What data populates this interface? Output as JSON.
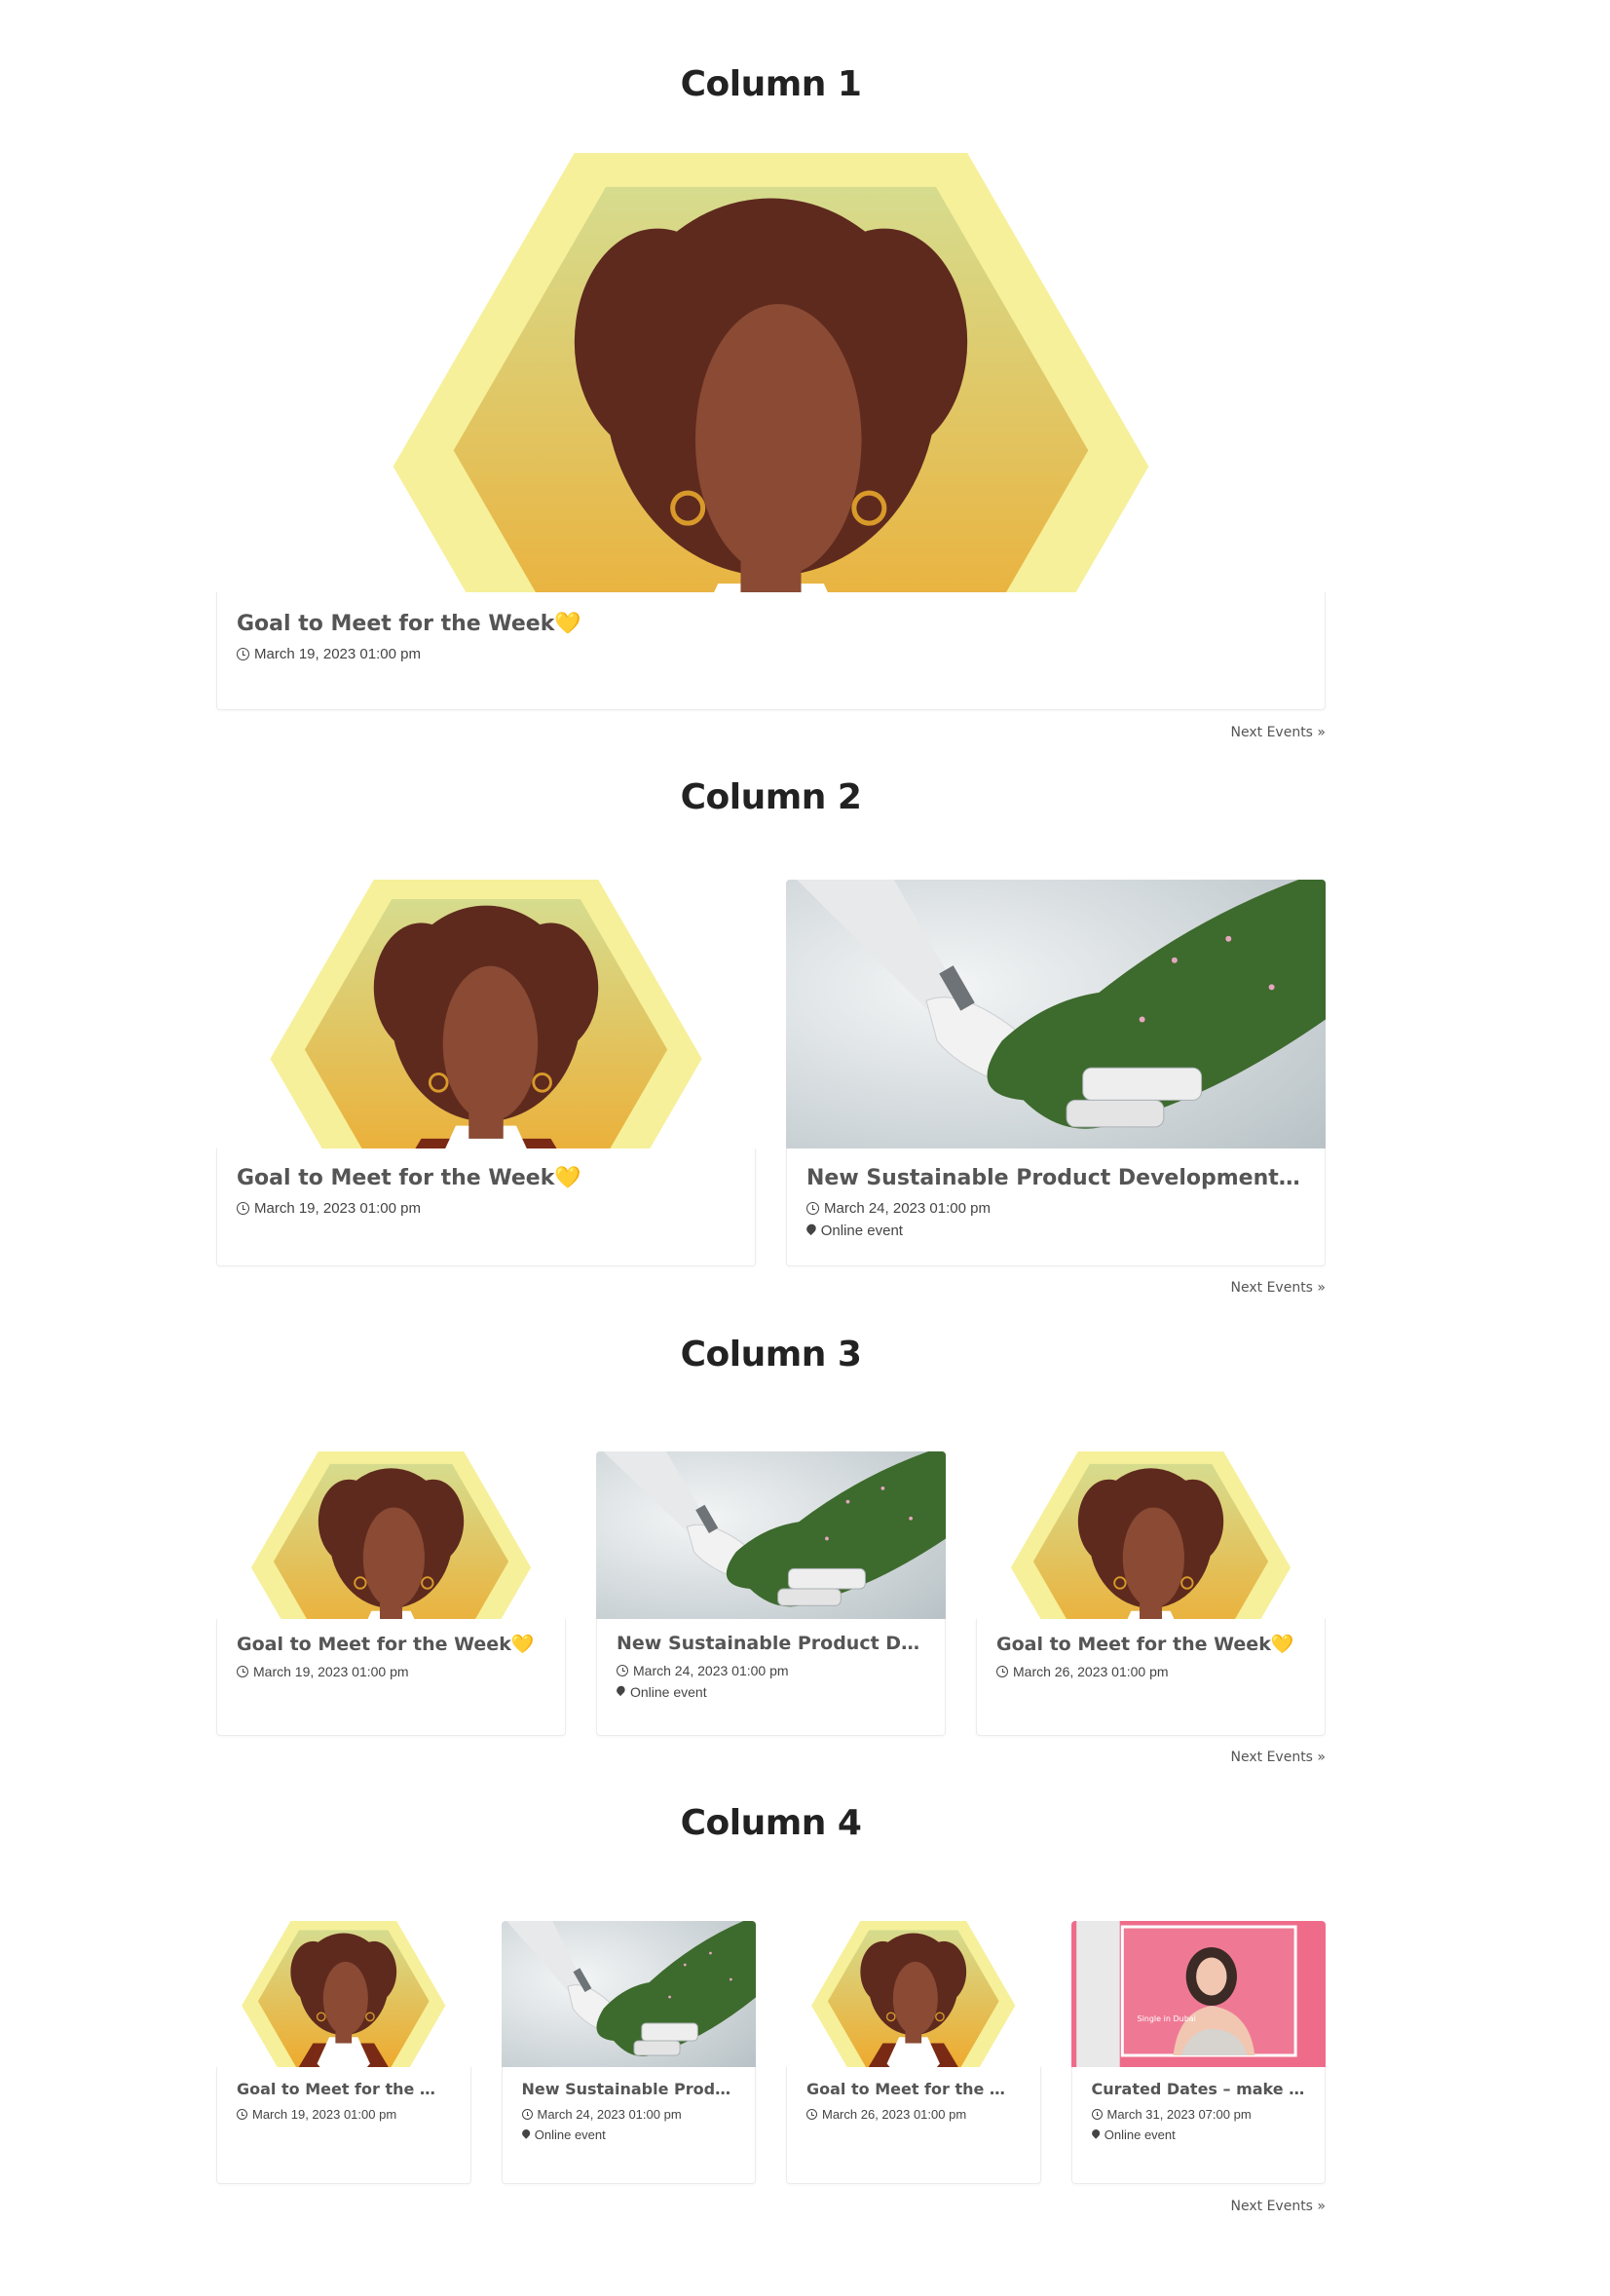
{
  "sections": [
    {
      "title": "Column 1",
      "next_label": "Next Events »",
      "events": [
        {
          "image": "woman-hexagon-avatar",
          "title": "Goal to Meet for the Week",
          "emoji": "💛",
          "date": "March 19, 2023 01:00 pm",
          "location": ""
        }
      ]
    },
    {
      "title": "Column 2",
      "next_label": "Next Events »",
      "events": [
        {
          "image": "woman-hexagon-avatar",
          "title": "Goal to Meet for the Week",
          "emoji": "💛",
          "date": "March 19, 2023 01:00 pm",
          "location": ""
        },
        {
          "image": "robot-handshake-photo",
          "title": "New Sustainable Product Development an...",
          "emoji": "",
          "date": "March 24, 2023 01:00 pm",
          "location": "Online event"
        }
      ]
    },
    {
      "title": "Column 3",
      "next_label": "Next Events »",
      "events": [
        {
          "image": "woman-hexagon-avatar",
          "title": "Goal to Meet for the Week",
          "emoji": "💛",
          "date": "March 19, 2023 01:00 pm",
          "location": ""
        },
        {
          "image": "robot-handshake-photo",
          "title": "New Sustainable Product Devel...",
          "emoji": "",
          "date": "March 24, 2023 01:00 pm",
          "location": "Online event"
        },
        {
          "image": "woman-hexagon-avatar",
          "title": "Goal to Meet for the Week",
          "emoji": "💛",
          "date": "March 26, 2023 01:00 pm",
          "location": ""
        }
      ]
    },
    {
      "title": "Column 4",
      "next_label": "Next Events »",
      "events": [
        {
          "image": "woman-hexagon-avatar",
          "title": "Goal to Meet for the Week...",
          "emoji": "",
          "date": "March 19, 2023 01:00 pm",
          "location": ""
        },
        {
          "image": "robot-handshake-photo",
          "title": "New Sustainable Product ...",
          "emoji": "",
          "date": "March 24, 2023 01:00 pm",
          "location": "Online event"
        },
        {
          "image": "woman-hexagon-avatar",
          "title": "Goal to Meet for the Week...",
          "emoji": "",
          "date": "March 26, 2023 01:00 pm",
          "location": ""
        },
        {
          "image": "woman-pink-backdrop-photo",
          "title": "Curated Dates – make mea...",
          "emoji": "",
          "date": "March 31, 2023 07:00 pm",
          "location": "Online event",
          "image_caption": "Single in Dubai"
        }
      ]
    }
  ],
  "icons": {
    "date": "clock-icon",
    "location": "map-pin-icon"
  },
  "colors": {
    "hex_outer": "#f6f09a",
    "hex_top": "#d6dc8e",
    "hex_bottom": "#efa82a",
    "hair": "#5e2a1e",
    "skin": "#8a4a33",
    "glove": "#3d6a2d",
    "pink": "#ee6c8a"
  }
}
